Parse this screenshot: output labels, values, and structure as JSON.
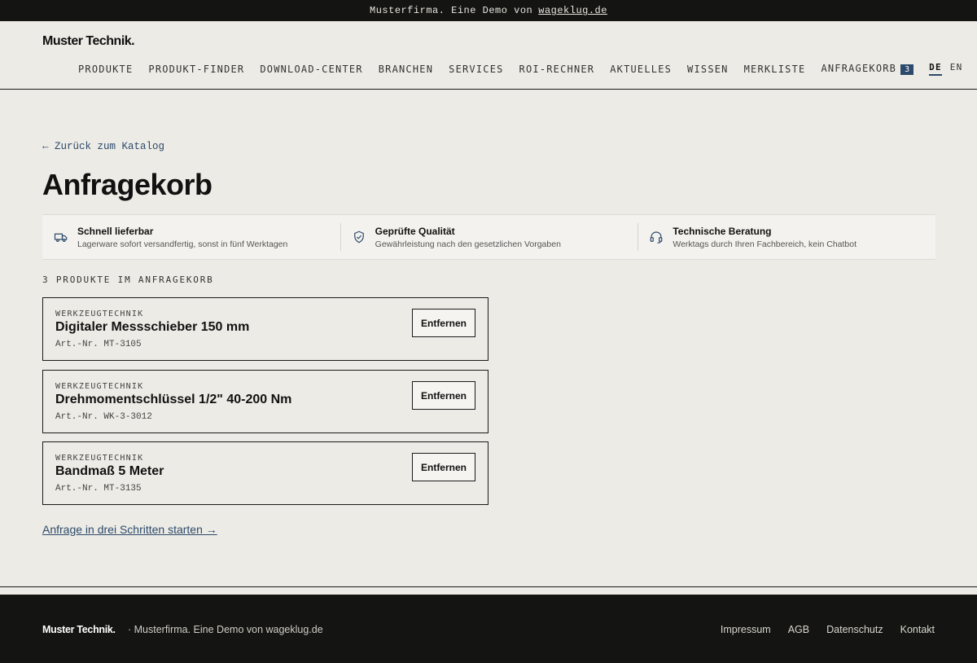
{
  "topbar": {
    "text": "Musterfirma. Eine Demo von",
    "link": "wageklug.de"
  },
  "header": {
    "logo": "Muster Technik.",
    "nav": [
      "PRODUKTE",
      "PRODUKT-FINDER",
      "DOWNLOAD-CENTER",
      "BRANCHEN",
      "SERVICES",
      "ROI-RECHNER",
      "AKTUELLES",
      "WISSEN",
      "MERKLISTE"
    ],
    "cart_label": "ANFRAGEKORB",
    "cart_count": "3",
    "lang_de": "DE",
    "lang_en": "EN"
  },
  "page": {
    "back": "← Zurück zum Katalog",
    "title": "Anfragekorb",
    "count_label": "3 PRODUKTE IM ANFRAGEKORB",
    "start_link": "Anfrage in drei Schritten starten →"
  },
  "features": [
    {
      "icon": "truck-icon",
      "title": "Schnell lieferbar",
      "desc": "Lagerware sofort versandfertig, sonst in fünf Werktagen"
    },
    {
      "icon": "shield-check-icon",
      "title": "Geprüfte Qualität",
      "desc": "Gewährleistung nach den gesetzlichen Vorgaben"
    },
    {
      "icon": "headset-icon",
      "title": "Technische Beratung",
      "desc": "Werktags durch Ihren Fachbereich, kein Chatbot"
    }
  ],
  "items": [
    {
      "category": "WERKZEUGTECHNIK",
      "name": "Digitaler Messschieber 150 mm",
      "art": "Art.-Nr. MT-3105",
      "remove": "Entfernen"
    },
    {
      "category": "WERKZEUGTECHNIK",
      "name": "Drehmomentschlüssel 1/2\" 40-200 Nm",
      "art": "Art.-Nr. WK-3-3012",
      "remove": "Entfernen"
    },
    {
      "category": "WERKZEUGTECHNIK",
      "name": "Bandmaß 5 Meter",
      "art": "Art.-Nr. MT-3135",
      "remove": "Entfernen"
    }
  ],
  "footer": {
    "logo": "Muster Technik.",
    "tagline": "· Musterfirma. Eine Demo von wageklug.de",
    "links": [
      "Impressum",
      "AGB",
      "Datenschutz",
      "Kontakt"
    ]
  },
  "colors": {
    "accent": "#2c4a6b",
    "background": "#edebe5",
    "dark": "#141412"
  }
}
